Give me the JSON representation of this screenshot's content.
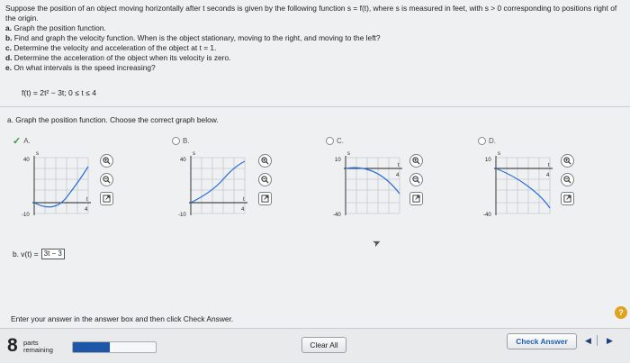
{
  "problem": {
    "intro": "Suppose the position of an object moving horizontally after t seconds is given by the following function s = f(t), where s is measured in feet, with s > 0 corresponding to positions right of the origin.",
    "items": [
      {
        "letter": "a.",
        "text": "Graph the position function."
      },
      {
        "letter": "b.",
        "text": "Find and graph the velocity function. When is the object stationary, moving to the right, and moving to the left?"
      },
      {
        "letter": "c.",
        "text": "Determine the velocity and acceleration of the object at t = 1."
      },
      {
        "letter": "d.",
        "text": "Determine the acceleration of the object when its velocity is zero."
      },
      {
        "letter": "e.",
        "text": "On what intervals is the speed increasing?"
      }
    ],
    "function": "f(t) = 2t² − 3t; 0 ≤ t ≤ 4"
  },
  "part_a": {
    "prompt": "a. Graph the position function. Choose the correct graph below.",
    "choices": [
      {
        "label": "A.",
        "selected": true,
        "ytop": "40",
        "ybottom": "-10",
        "xright": "4"
      },
      {
        "label": "B.",
        "selected": false,
        "ytop": "40",
        "ybottom": "-10",
        "xright": "4"
      },
      {
        "label": "C.",
        "selected": false,
        "ytop": "10",
        "ybottom": "-40",
        "xright": "4"
      },
      {
        "label": "D.",
        "selected": false,
        "ytop": "10",
        "ybottom": "-40",
        "xright": "4"
      }
    ],
    "axis_s": "s",
    "axis_t": "t"
  },
  "part_b": {
    "label": "b. v(t) =",
    "answer": "3t − 3"
  },
  "instruction": "Enter your answer in the answer box and then click Check Answer.",
  "help": "?",
  "footer": {
    "parts_count": "8",
    "parts_line1": "parts",
    "parts_line2": "remaining",
    "progress_fraction": 0.45,
    "clear_all": "Clear All",
    "check_answer": "Check Answer",
    "prev": "◀",
    "next": "▶"
  },
  "colors": {
    "curve": "#2a6fd6",
    "selected_check": "#3a9a3a",
    "progress_fill": "#1e57a8"
  },
  "icons": [
    "zoom-in-icon",
    "zoom-out-icon",
    "expand-icon"
  ]
}
